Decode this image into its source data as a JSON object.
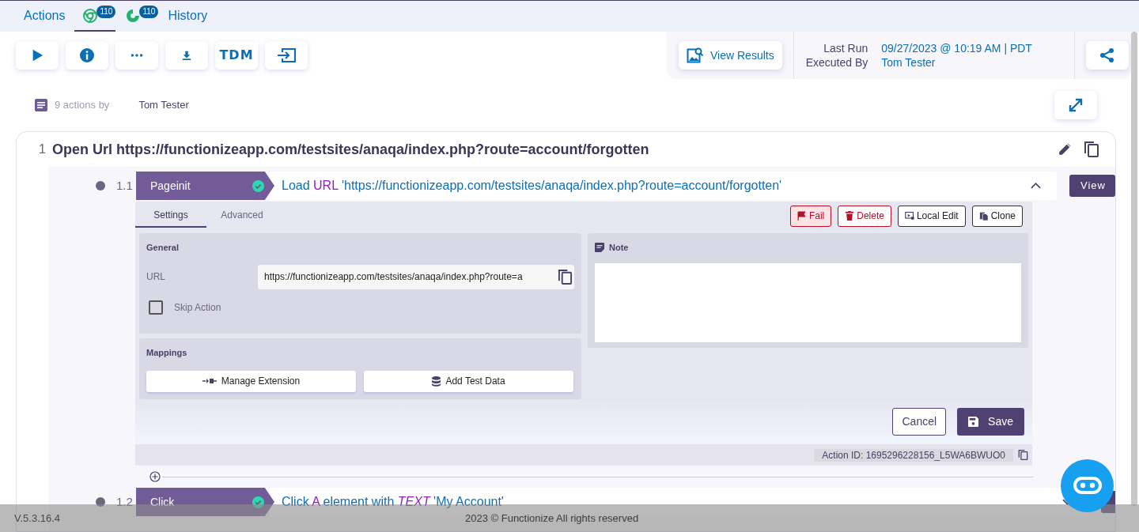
{
  "tabs": [
    {
      "kind": "text",
      "label": "Actions",
      "selected": false
    },
    {
      "kind": "chrome",
      "badge": "110",
      "selected": true
    },
    {
      "kind": "refresh",
      "badge": "110",
      "selected": false
    },
    {
      "kind": "text",
      "label": "History",
      "selected": false
    }
  ],
  "toolbar": [
    {
      "kind": "play"
    },
    {
      "kind": "info"
    },
    {
      "kind": "more"
    },
    {
      "kind": "download"
    },
    {
      "kind": "label",
      "label": "TDM"
    },
    {
      "kind": "exit"
    }
  ],
  "results": {
    "button": "View Results",
    "last_run_label": "Last Run",
    "last_run_value": "09/27/2023 @ 10:19 AM | PDT",
    "executed_by_label": "Executed By",
    "executed_by_value": "Tom Tester"
  },
  "summary": {
    "text": "9 actions by",
    "author": "Tom Tester"
  },
  "steps": [
    {
      "number": "1",
      "title": "Open Url https://functionizeapp.com/testsites/anaqa/index.php?route=account/forgotten",
      "actions": [
        {
          "number": "1.1",
          "type": "Pageinit",
          "passed": true,
          "expanded": true,
          "view": "View",
          "description": [
            {
              "kind": "plain",
              "text": "Load"
            },
            {
              "kind": "keyword",
              "text": "URL"
            },
            {
              "kind": "plain",
              "text": "'https://functionizeapp.com/testsites/anaqa/index.php?route=account/forgotten'"
            }
          ]
        },
        {
          "number": "1.2",
          "type": "Click",
          "passed": true,
          "expanded": false,
          "description": [
            {
              "kind": "plain",
              "text": "Click"
            },
            {
              "kind": "keyword",
              "text": "A"
            },
            {
              "kind": "plain",
              "text": "element with"
            },
            {
              "kind": "emphasis",
              "text": "TEXT"
            },
            {
              "kind": "plain",
              "text": "'My Account'"
            }
          ]
        }
      ]
    }
  ],
  "panel": {
    "tabs": [
      {
        "label": "Settings",
        "selected": true
      },
      {
        "label": "Advanced",
        "selected": false
      }
    ],
    "buttons": [
      {
        "kind": "fail",
        "label": "Fail"
      },
      {
        "kind": "delete",
        "label": "Delete"
      },
      {
        "kind": "local",
        "label": "Local Edit"
      },
      {
        "kind": "clone",
        "label": "Clone"
      }
    ],
    "general": {
      "title": "General",
      "url_label": "URL",
      "url_value": "https://functionizeapp.com/testsites/anaqa/index.php?route=a",
      "skip_label": "Skip Action",
      "skip_checked": false
    },
    "note": {
      "title": "Note"
    },
    "mappings": {
      "title": "Mappings",
      "buttons": [
        {
          "kind": "extension",
          "label": "Manage Extension"
        },
        {
          "kind": "data",
          "label": "Add Test Data"
        }
      ]
    },
    "cancel": "Cancel",
    "save": "Save",
    "action_id": "Action ID: 1695296228156_L5WA6BWUO0"
  },
  "footer": {
    "version": "V.5.3.16.4",
    "copyright": "2023 © Functionize All rights reserved"
  }
}
